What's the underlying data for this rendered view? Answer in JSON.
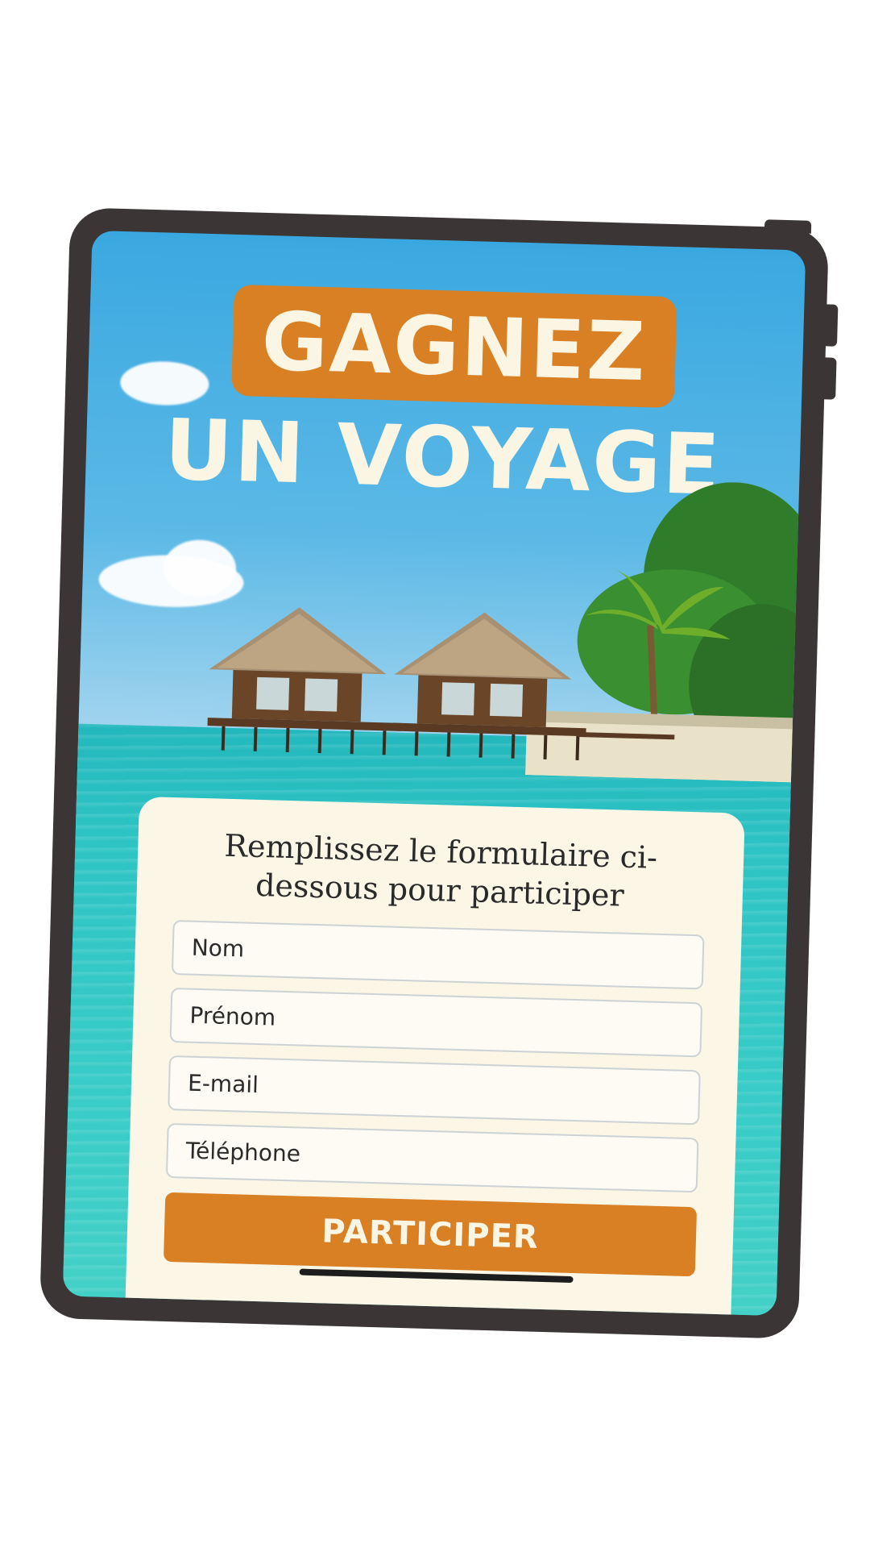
{
  "hero": {
    "title_line1": "GAGNEZ",
    "title_line2": "UN VOYAGE"
  },
  "form": {
    "instructions": "Remplissez le formulaire ci-dessous pour participer",
    "fields": [
      {
        "placeholder": "Nom"
      },
      {
        "placeholder": "Prénom"
      },
      {
        "placeholder": "E-mail"
      },
      {
        "placeholder": "Téléphone"
      }
    ],
    "submit_label": "PARTICIPER"
  },
  "colors": {
    "accent": "#d97f24",
    "title_text": "#fbf5e4",
    "card_bg": "#fbf6e6",
    "device_frame": "#3b3536"
  },
  "illustration": {
    "subject": "overwater-bungalows-tropical-beach"
  }
}
